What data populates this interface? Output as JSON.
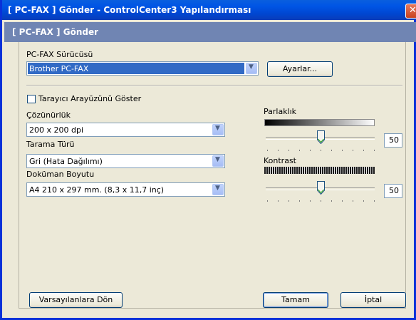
{
  "window": {
    "title": "[ PC-FAX ]  Gönder - ControlCenter3 Yapılandırması",
    "close_symbol": "✕"
  },
  "header": {
    "title": "[ PC-FAX ]  Gönder"
  },
  "driver": {
    "label": "PC-FAX Sürücüsü",
    "value": "Brother PC-FAX",
    "settings_button": "Ayarlar..."
  },
  "scanner_ui": {
    "label": "Tarayıcı Arayüzünü Göster",
    "checked": false
  },
  "resolution": {
    "label": "Çözünürlük",
    "value": "200 x 200 dpi"
  },
  "scan_type": {
    "label": "Tarama Türü",
    "value": "Gri (Hata Dağılımı)"
  },
  "doc_size": {
    "label": "Doküman Boyutu",
    "value": "A4 210 x 297 mm. (8,3 x 11,7 inç)"
  },
  "brightness": {
    "label": "Parlaklık",
    "value": "50"
  },
  "contrast": {
    "label": "Kontrast",
    "value": "50"
  },
  "footer": {
    "defaults_button": "Varsayılanlara Dön",
    "ok_button": "Tamam",
    "cancel_button": "İptal"
  },
  "icons": {
    "dropdown": "chevron-down-icon",
    "close": "close-icon"
  }
}
